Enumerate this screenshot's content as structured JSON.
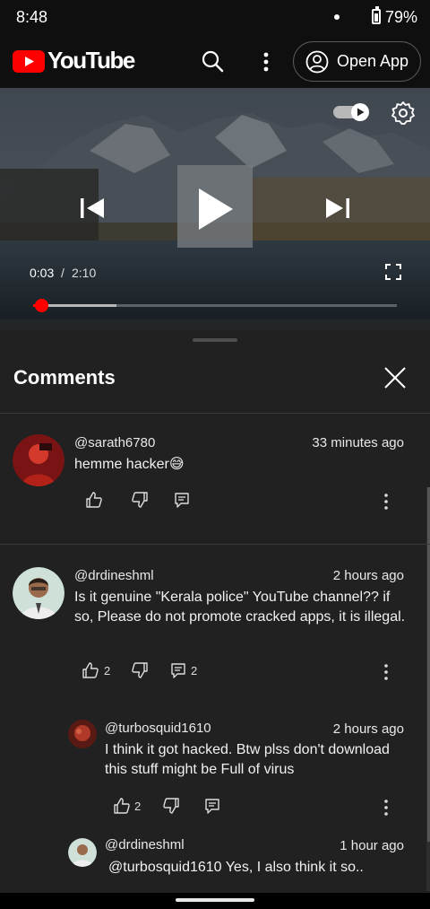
{
  "status": {
    "time": "8:48",
    "battery": "79%"
  },
  "header": {
    "brand": "YouTube",
    "open_app_label": "Open App"
  },
  "player": {
    "current_time": "0:03",
    "separator": "/",
    "total_time": "2:10",
    "progress": 0.023,
    "buffered": 0.23
  },
  "comments_panel": {
    "title": "Comments",
    "comments": [
      {
        "author": "@sarath6780",
        "time": "33 minutes ago",
        "text": "hemme hacker😅",
        "likes": "",
        "replies": ""
      },
      {
        "author": "@drdineshml",
        "time": "2 hours ago",
        "text": "Is it genuine \"Kerala police\" YouTube channel?? if so, Please do not promote cracked apps, it is illegal.",
        "likes": "2",
        "replies": "2"
      }
    ],
    "replies": [
      {
        "author": "@turbosquid1610",
        "time": "2 hours ago",
        "text": "I think it got hacked. Btw plss don't download this stuff might be Full of virus",
        "likes": "2"
      },
      {
        "author": "@drdineshml",
        "time": "1 hour ago",
        "text": "@turbosquid1610  Yes, I also think it so.."
      }
    ]
  }
}
